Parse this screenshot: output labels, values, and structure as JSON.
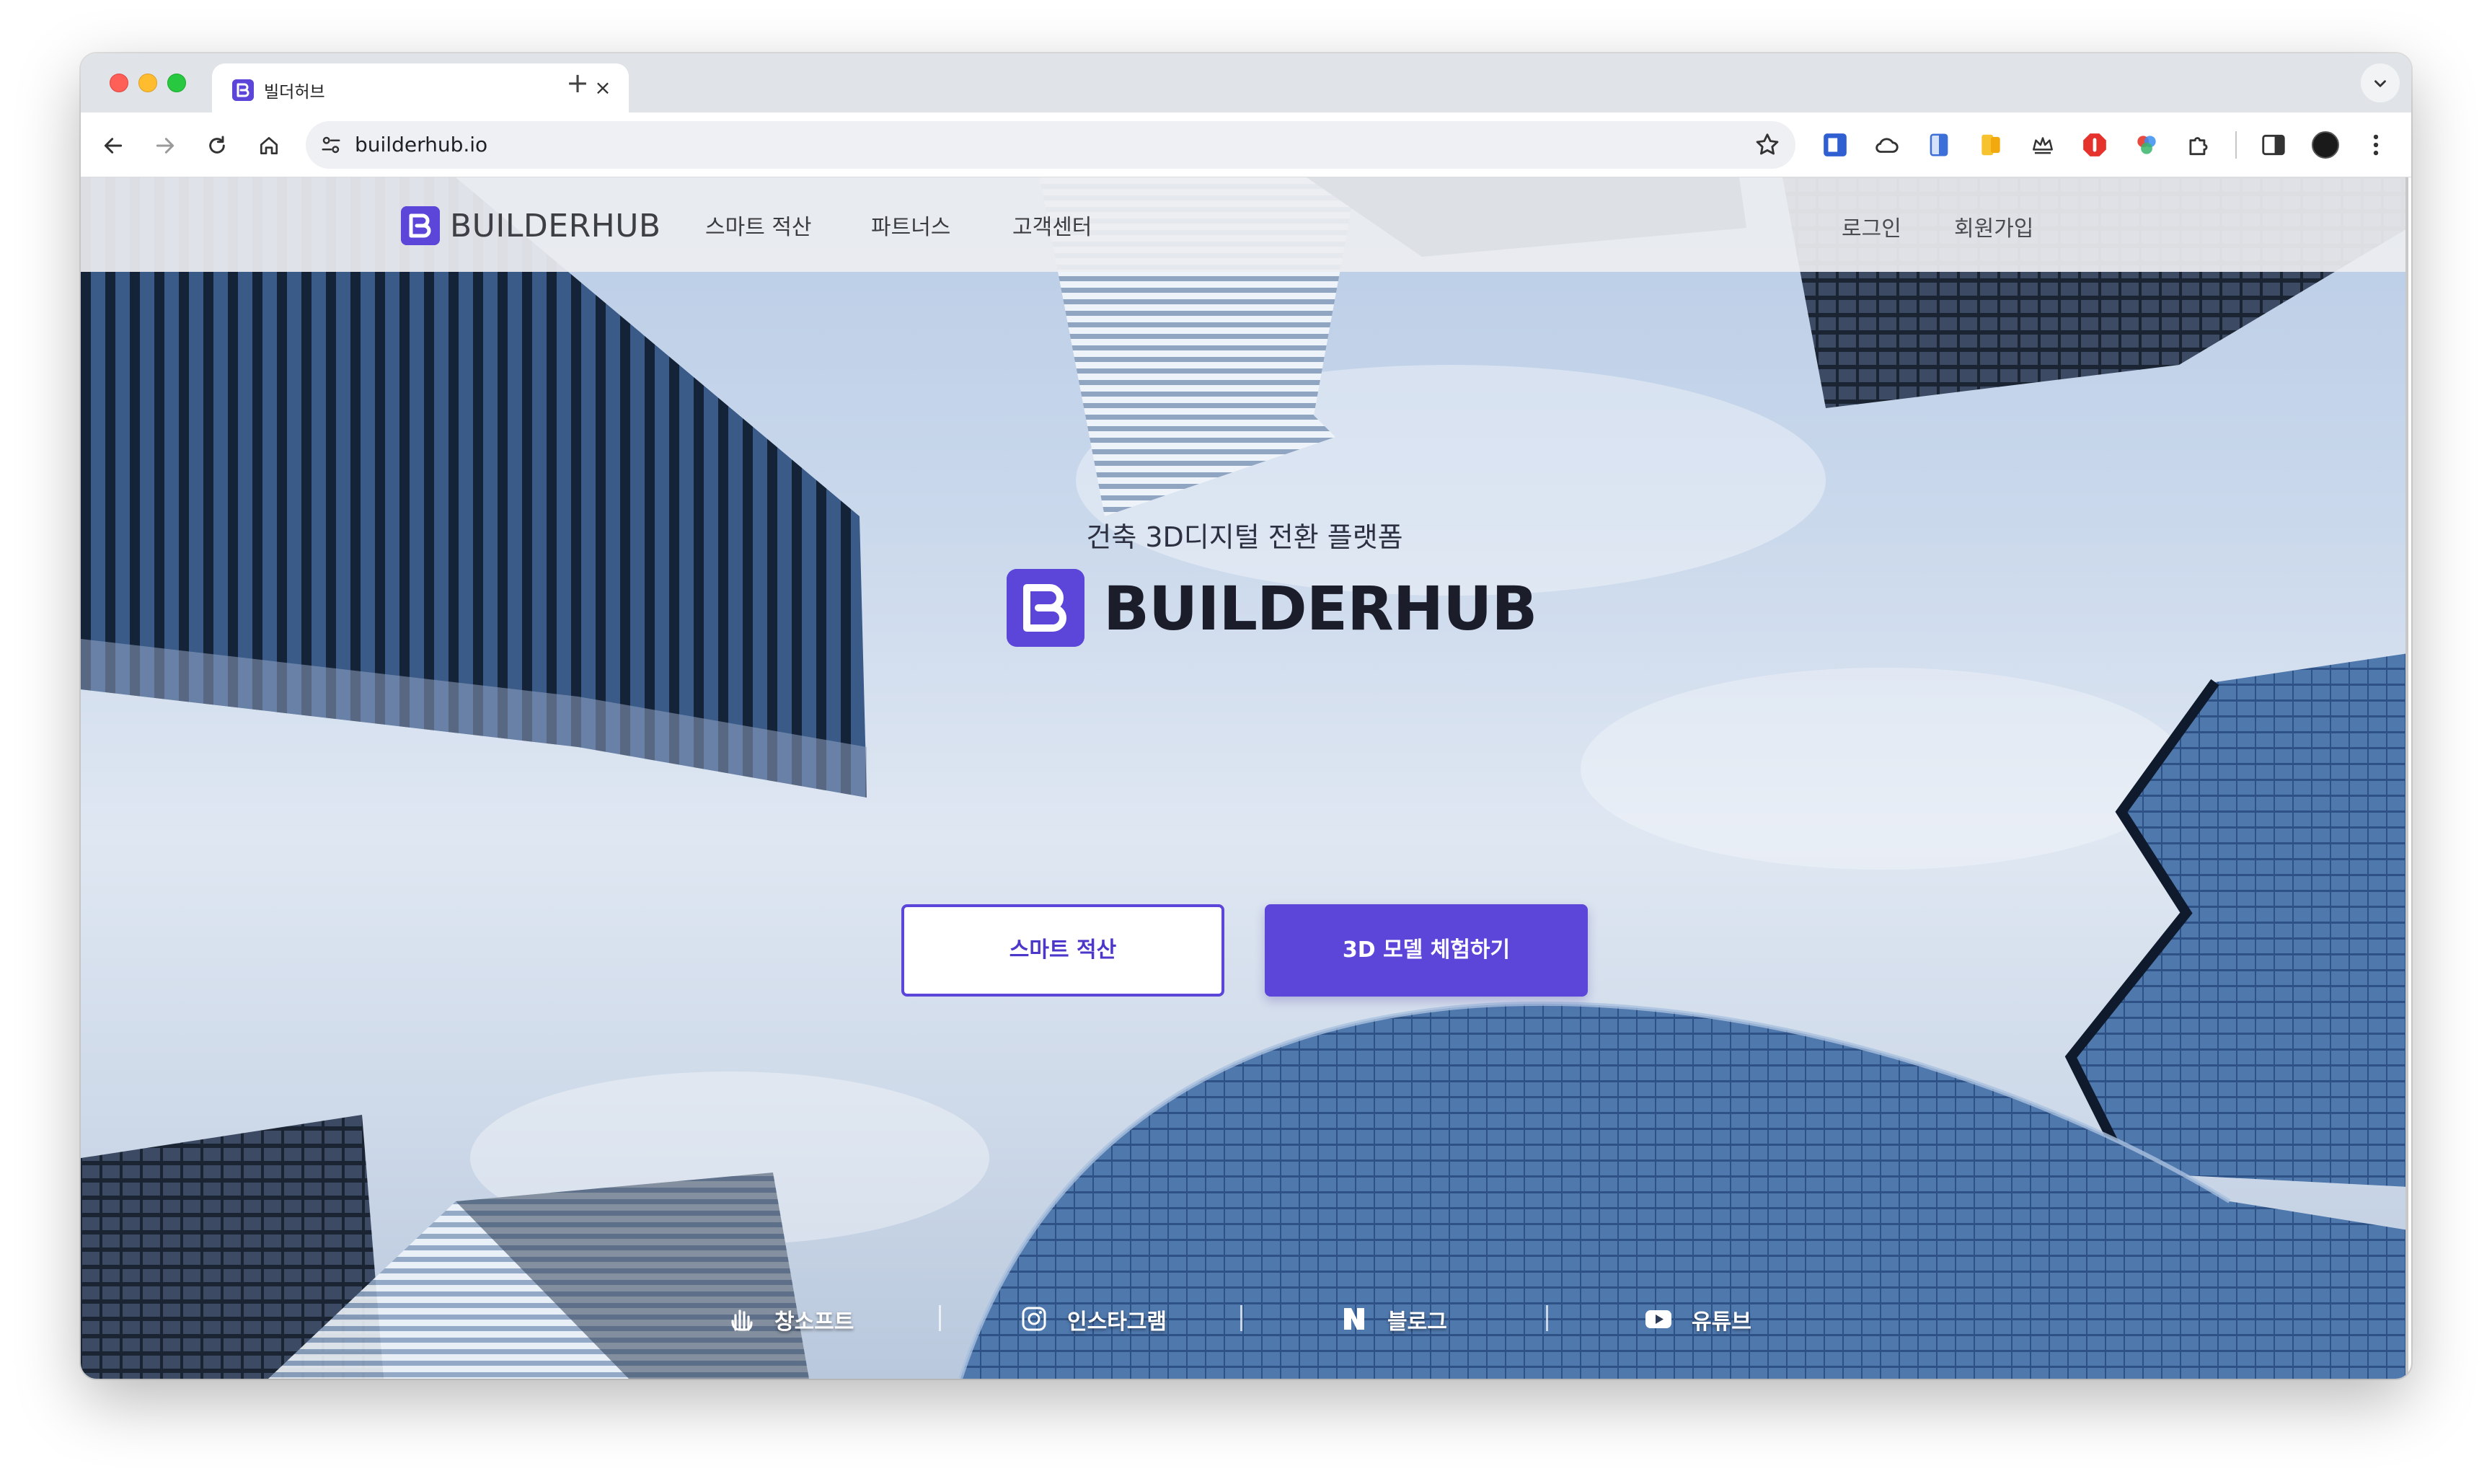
{
  "browser": {
    "tab_title": "빌더허브",
    "tab_favicon_icon": "builderhub-favicon-icon",
    "new_tab": "+",
    "close": "×",
    "url": "builderhub.io"
  },
  "site": {
    "brand": "BUILDERHUB",
    "brand_color": "#5b46d9",
    "nav": [
      "스마트 적산",
      "파트너스",
      "고객센터"
    ],
    "auth": {
      "login": "로그인",
      "signup": "회원가입"
    }
  },
  "hero": {
    "subtitle": "건축 3D디지털 전환 플랫폼",
    "title": "BUILDERHUB",
    "primary_outline_button": "스마트 적산",
    "primary_solid_button": "3D 모델 체험하기"
  },
  "social": [
    {
      "label": "창소프트",
      "icon": "changsoft-hand-icon"
    },
    {
      "label": "인스타그램",
      "icon": "instagram-icon"
    },
    {
      "label": "블로그",
      "icon": "naver-blog-icon"
    },
    {
      "label": "유튜브",
      "icon": "youtube-icon"
    }
  ]
}
